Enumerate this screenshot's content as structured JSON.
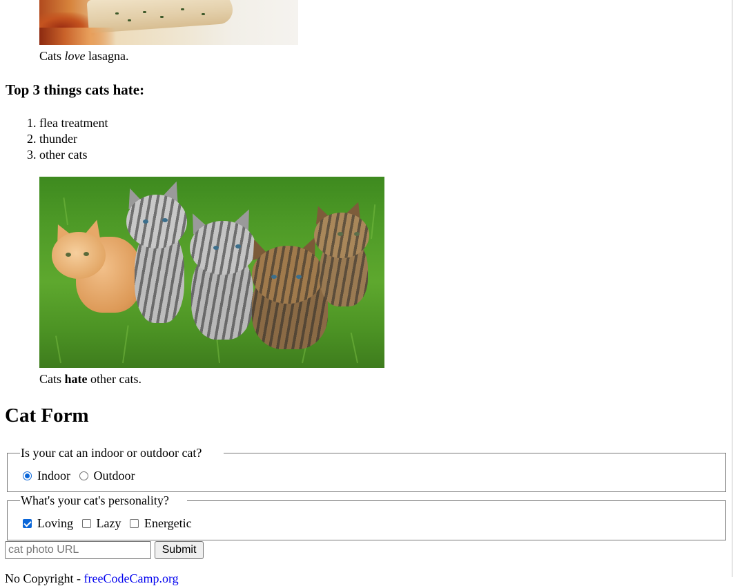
{
  "images": {
    "lasagna_caption_prefix": "Cats ",
    "lasagna_caption_emphasis": "love",
    "lasagna_caption_suffix": " lasagna.",
    "kittens_caption_prefix": "Cats ",
    "kittens_caption_strong": "hate",
    "kittens_caption_suffix": " other cats."
  },
  "hate_section": {
    "title": "Top 3 things cats hate:",
    "items": [
      "flea treatment",
      "thunder",
      "other cats"
    ]
  },
  "form": {
    "title": "Cat Form",
    "location_legend": "Is your cat an indoor or outdoor cat?",
    "location_options": [
      {
        "label": "Indoor",
        "checked": true
      },
      {
        "label": "Outdoor",
        "checked": false
      }
    ],
    "personality_legend": "What's your cat's personality?",
    "personality_options": [
      {
        "label": "Loving",
        "checked": true
      },
      {
        "label": "Lazy",
        "checked": false
      },
      {
        "label": "Energetic",
        "checked": false
      }
    ],
    "url_placeholder": "cat photo URL",
    "submit_label": "Submit"
  },
  "footer": {
    "text": "No Copyright - ",
    "link_label": "freeCodeCamp.org"
  },
  "colors": {
    "accent": "#0a66d8",
    "link": "#0000ee"
  }
}
